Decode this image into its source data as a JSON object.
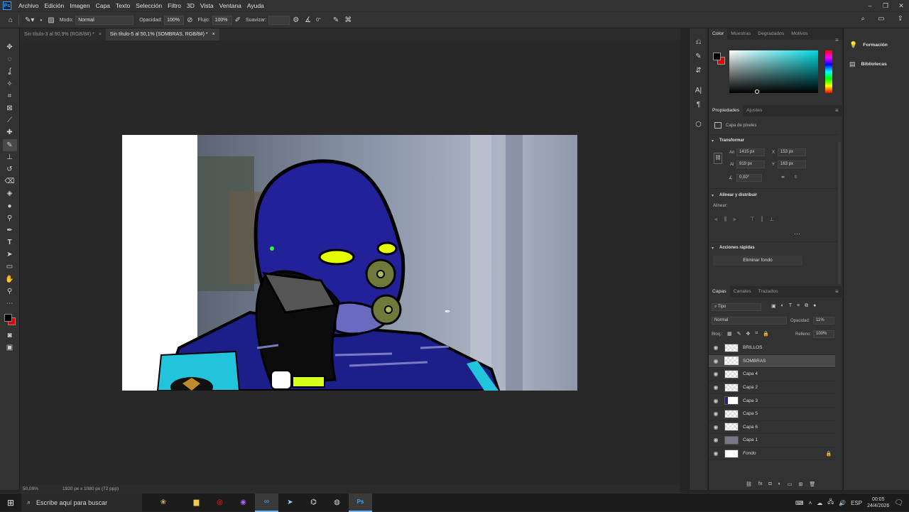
{
  "menu": [
    "Archivo",
    "Edición",
    "Imagen",
    "Capa",
    "Texto",
    "Selección",
    "Filtro",
    "3D",
    "Vista",
    "Ventana",
    "Ayuda"
  ],
  "window_controls": [
    "–",
    "❐",
    "✕"
  ],
  "options": {
    "mode_label": "Modo:",
    "mode_value": "Normal",
    "opacity_label": "Opacidad:",
    "opacity_value": "100%",
    "flow_label": "Flujo:",
    "flow_value": "100%",
    "smooth_label": "Suavizar:",
    "angle_value": "0°"
  },
  "tabs": [
    {
      "label": "Sin título-3 al 90,9% (RGB/8#) *",
      "close": "×"
    },
    {
      "label": "Sin título-5 al 50,1% (SOMBRAS, RGB/8#) *",
      "close": "×"
    }
  ],
  "status": {
    "zoom": "50,09%",
    "dimensions": "1920 px x 1080 px (72 ppp)"
  },
  "color_panel": {
    "tabs": [
      "Color",
      "Muestras",
      "Degradados",
      "Motivos"
    ]
  },
  "properties_panel": {
    "tabs": [
      "Propiedades",
      "Ajustes"
    ],
    "layer_type": "Capa de píxeles",
    "transform_title": "Transformar",
    "w_label": "An",
    "w_value": "1415 px",
    "x_label": "X",
    "x_value": "153 px",
    "h_label": "Al",
    "h_value": "919 px",
    "y_label": "Y",
    "y_value": "163 px",
    "angle_value": "0,00°",
    "align_title": "Alinear y distribuir",
    "align_label": "Alinear:",
    "quick_title": "Acciones rápidas",
    "remove_bg": "Eliminar fondo"
  },
  "layers_panel": {
    "tabs": [
      "Capas",
      "Canales",
      "Trazados"
    ],
    "filter": "Tipo",
    "blend_mode": "Normal",
    "opacity_label": "Opacidad:",
    "opacity_value": "11%",
    "lock_label": "Bloq.:",
    "fill_label": "Relleno:",
    "fill_value": "100%",
    "layers": [
      {
        "name": "BRILLOS"
      },
      {
        "name": "SOMBRAS"
      },
      {
        "name": "Capa 4"
      },
      {
        "name": "Capa 2"
      },
      {
        "name": "Capa 3"
      },
      {
        "name": "Capa 5"
      },
      {
        "name": "Capa 6"
      },
      {
        "name": "Capa 1"
      },
      {
        "name": "Fondo"
      }
    ]
  },
  "far_right": {
    "learn": "Formación",
    "libraries": "Bibliotecas"
  },
  "taskbar": {
    "search_placeholder": "Escribe aquí para buscar",
    "lang": "ESP",
    "time": "00:05",
    "date": "24/4/2026"
  },
  "colors": {
    "foreground": "#000000",
    "background": "#e30000",
    "hue_selected": "#00d8e0"
  }
}
